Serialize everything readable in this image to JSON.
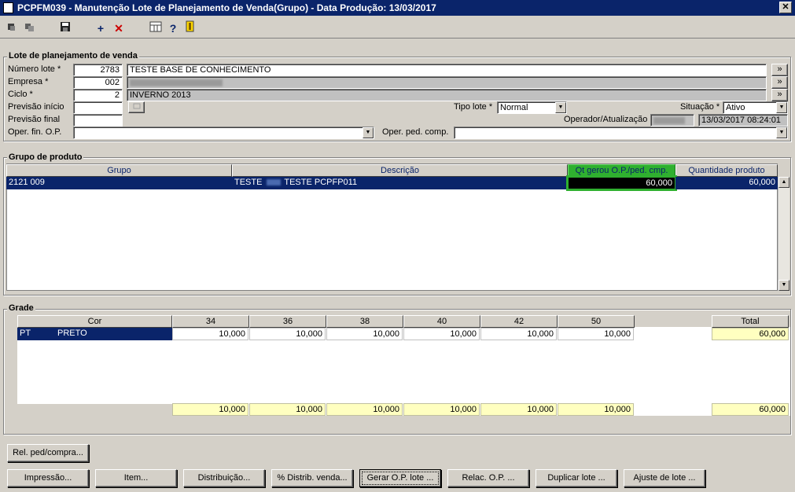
{
  "window": {
    "title": "PCPFM039 - Manutenção Lote de Planejamento de Venda(Grupo) - Data Produção: 13/03/2017",
    "close_label": "✕"
  },
  "toolbar": {
    "add_label": "+",
    "delete_label": "✕",
    "help_label": "?"
  },
  "lote": {
    "section_title": "Lote de planejamento de venda",
    "numero_label": "Número lote *",
    "numero_value": "2783",
    "numero_desc": "TESTE BASE DE CONHECIMENTO",
    "empresa_label": "Empresa *",
    "empresa_value": "002",
    "ciclo_label": "Ciclo *",
    "ciclo_value": "2",
    "ciclo_desc": "INVERNO 2013",
    "prev_inicio_label": "Previsão início",
    "prev_final_label": "Previsão final",
    "oper_fin_label": "Oper. fin. O.P.",
    "oper_ped_label": "Oper. ped. comp.",
    "tipo_lote_label": "Tipo lote *",
    "tipo_lote_value": "Normal",
    "situacao_label": "Situação *",
    "situacao_value": "Ativo",
    "operador_label": "Operador/Atualização",
    "operador_datetime": "13/03/2017 08:24:01",
    "expand_label": "»"
  },
  "grupo": {
    "section_title": "Grupo de produto",
    "columns": [
      "Grupo",
      "Descrição",
      "Qt gerou O.P./ped. cmp.",
      "Quantidade produto"
    ],
    "row": {
      "grupo": "2121 009",
      "descricao_a": "TESTE",
      "descricao_b": "TESTE PCPFP011",
      "qt_gerou": "60,000",
      "quantidade": "60,000"
    }
  },
  "grade": {
    "section_title": "Grade",
    "cor_header": "Cor",
    "sizes": [
      "34",
      "36",
      "38",
      "40",
      "42",
      "50"
    ],
    "total_header": "Total",
    "row": {
      "cor_code": "PT",
      "cor_name": "PRETO",
      "values": [
        "10,000",
        "10,000",
        "10,000",
        "10,000",
        "10,000",
        "10,000"
      ],
      "total": "60,000"
    },
    "footer_values": [
      "10,000",
      "10,000",
      "10,000",
      "10,000",
      "10,000",
      "10,000"
    ],
    "footer_total": "60,000"
  },
  "buttons": {
    "rel_ped": "Rel. ped/compra...",
    "impressao": "Impressão...",
    "item": "Item...",
    "distribuicao": "Distribuição...",
    "perc_distrib": "% Distrib. venda...",
    "gerar_op": "Gerar O.P. lote ...",
    "relac_op": "Relac. O.P. ...",
    "duplicar": "Duplicar lote ...",
    "ajuste": "Ajuste de lote ..."
  }
}
